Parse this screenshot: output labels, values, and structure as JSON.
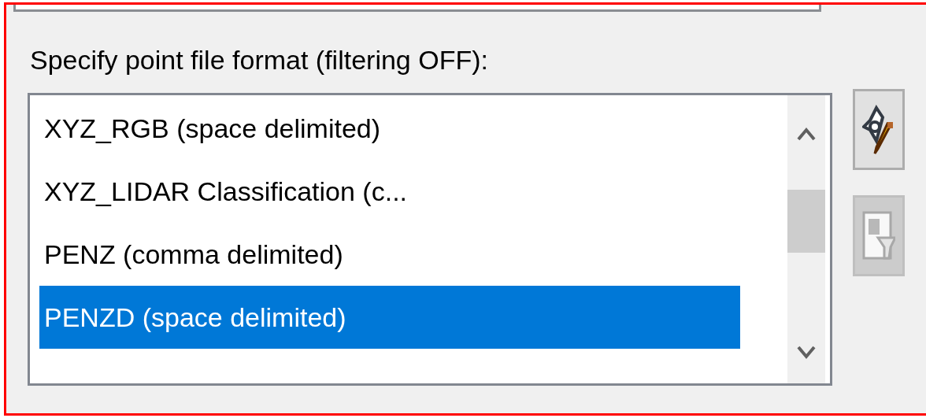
{
  "format_label": "Specify point file format (filtering OFF):",
  "formats": [
    {
      "label": "XYZ_RGB (space delimited)",
      "selected": false
    },
    {
      "label": "XYZ_LIDAR Classification (c...",
      "selected": false
    },
    {
      "label": "PENZ (comma delimited)",
      "selected": false
    },
    {
      "label": "PENZD (space delimited)",
      "selected": true
    }
  ],
  "side_buttons": [
    {
      "kind": "edit",
      "disabled": false
    },
    {
      "kind": "filter",
      "disabled": true
    }
  ]
}
